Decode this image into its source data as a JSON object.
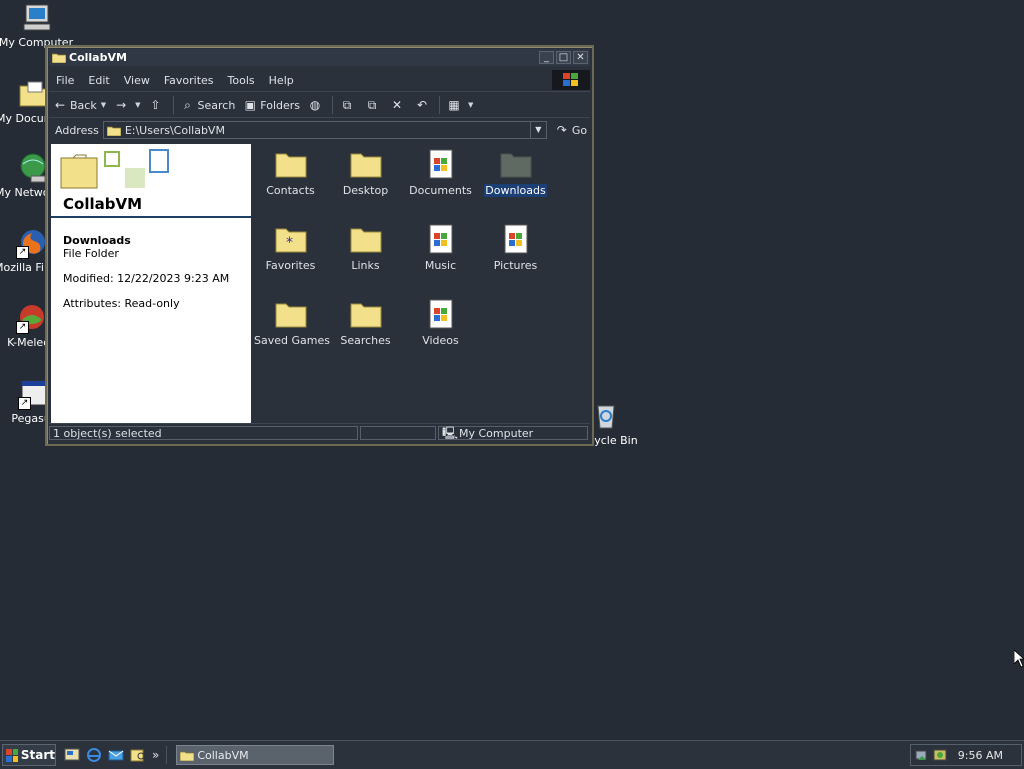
{
  "desktop": {
    "icons": [
      {
        "label": "My Computer"
      },
      {
        "label": "My Documents"
      },
      {
        "label": "My Network Places"
      },
      {
        "label": "Mozilla Firefox"
      },
      {
        "label": "K-Meleon"
      },
      {
        "label": "Pegasus"
      },
      {
        "label": "Recycle Bin"
      }
    ]
  },
  "window": {
    "title": "CollabVM",
    "menu": [
      "File",
      "Edit",
      "View",
      "Favorites",
      "Tools",
      "Help"
    ],
    "toolbar": {
      "back": "Back",
      "search": "Search",
      "folders": "Folders"
    },
    "address": {
      "label": "Address",
      "value": "E:\\Users\\CollabVM",
      "go": "Go"
    },
    "details": {
      "folder_title": "CollabVM",
      "selected_name": "Downloads",
      "selected_type": "File Folder",
      "modified": "Modified: 12/22/2023 9:23 AM",
      "attributes": "Attributes: Read-only"
    },
    "items": [
      {
        "label": "Contacts",
        "kind": "folder"
      },
      {
        "label": "Desktop",
        "kind": "folder"
      },
      {
        "label": "Documents",
        "kind": "doc"
      },
      {
        "label": "Downloads",
        "kind": "folder-selected"
      },
      {
        "label": "Favorites",
        "kind": "folder-star"
      },
      {
        "label": "Links",
        "kind": "folder"
      },
      {
        "label": "Music",
        "kind": "doc"
      },
      {
        "label": "Pictures",
        "kind": "doc"
      },
      {
        "label": "Saved Games",
        "kind": "folder"
      },
      {
        "label": "Searches",
        "kind": "folder"
      },
      {
        "label": "Videos",
        "kind": "doc"
      }
    ],
    "status": {
      "selection": "1 object(s) selected",
      "zone": "My Computer"
    }
  },
  "taskbar": {
    "start": "Start",
    "task": "CollabVM",
    "more": "»",
    "clock": "9:56 AM"
  },
  "colors": {
    "desktop": "#252c35",
    "selection": "#1c3f76",
    "folder": "#f2e08a"
  }
}
